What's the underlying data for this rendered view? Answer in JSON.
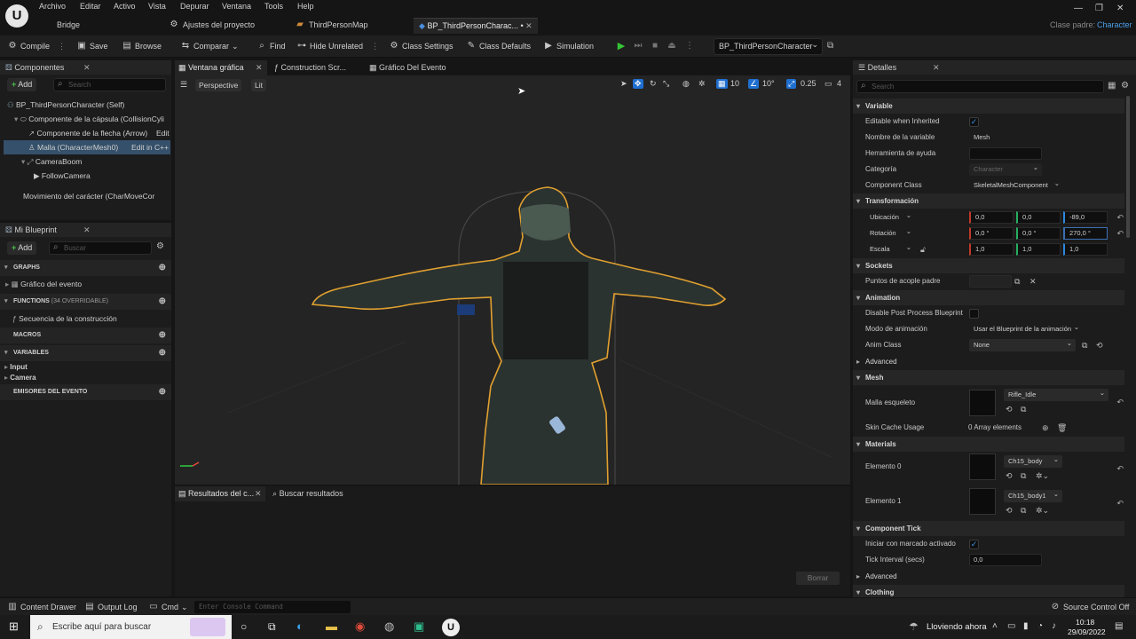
{
  "menu": [
    "Archivo",
    "Editar",
    "Activo",
    "Vista",
    "Depurar",
    "Ventana",
    "Tools",
    "Help"
  ],
  "project_tabs": [
    "Bridge",
    "Ajustes del proyecto",
    "ThirdPersonMap",
    "BP_ThirdPersonCharac... •"
  ],
  "parent_class_label": "Clase padre:",
  "parent_class_value": "Character",
  "toolbar": {
    "compile": "Compile",
    "save": "Save",
    "browse": "Browse",
    "compare": "Comparar",
    "find": "Find",
    "hide_unrelated": "Hide Unrelated",
    "class_settings": "Class Settings",
    "class_defaults": "Class Defaults",
    "simulation": "Simulation",
    "debug_object": "BP_ThirdPersonCharacter"
  },
  "components_panel": {
    "title": "Componentes",
    "add": "Add",
    "search_placeholder": "Search",
    "items": [
      {
        "label": "BP_ThirdPersonCharacter (Self)"
      },
      {
        "label": "Componente de la cápsula (CollisionCyli"
      },
      {
        "label": "Componente de la flecha (Arrow)",
        "action": "Edit"
      },
      {
        "label": "Malla (CharacterMesh0)",
        "action": "Edit in C++"
      },
      {
        "label": "CameraBoom"
      },
      {
        "label": "FollowCamera"
      },
      {
        "label": "Movimiento del carácter (CharMoveCor"
      }
    ]
  },
  "blueprint_panel": {
    "title": "Mi Blueprint",
    "add": "Add",
    "search_placeholder": "Buscar",
    "sections": {
      "graphs": "GRAPHS",
      "graph_item": "Gráfico del evento",
      "functions": "FUNCTIONS",
      "functions_note": "(34 OVERRIDABLE)",
      "function_item": "Secuencia de la construcción",
      "macros": "MACROS",
      "variables": "VARIABLES",
      "var_input": "Input",
      "var_camera": "Camera",
      "dispatchers": "EMISORES DEL EVENTO"
    }
  },
  "editor_tabs": [
    "Ventana gráfica",
    "Construction Scr...",
    "Gráfico Del Evento"
  ],
  "viewport": {
    "perspective": "Perspective",
    "lit": "Lit",
    "grid": "10",
    "angle": "10°",
    "scale": "0.25",
    "camera_speed": "4"
  },
  "results_panel": {
    "tab": "Resultados del c...",
    "search": "Buscar resultados",
    "clear": "Borrar"
  },
  "details": {
    "title": "Detalles",
    "search_placeholder": "Search",
    "variable_section": "Variable",
    "editable_inherited": "Editable when Inherited",
    "var_name_label": "Nombre de la variable",
    "var_name_value": "Mesh",
    "tooltip_label": "Herramienta de ayuda",
    "category_label": "Categoría",
    "category_value": "Character",
    "component_class_label": "Component Class",
    "component_class_value": "SkeletalMeshComponent",
    "transform_section": "Transformación",
    "location": "Ubicación",
    "rotation": "Rotación",
    "scale": "Escala",
    "loc": [
      "0,0",
      "0,0",
      "-89,0"
    ],
    "rot": [
      "0,0 °",
      "0,0 °",
      "270,0 °"
    ],
    "scl": [
      "1,0",
      "1,0",
      "1,0"
    ],
    "sockets_section": "Sockets",
    "parent_socket": "Puntos de acople padre",
    "animation_section": "Animation",
    "disable_post": "Disable Post Process Blueprint",
    "anim_mode_label": "Modo de animación",
    "anim_mode_value": "Usar el Blueprint de la animación",
    "anim_class_label": "Anim Class",
    "anim_class_value": "None",
    "advanced": "Advanced",
    "mesh_section": "Mesh",
    "skeletal_mesh_label": "Malla esqueleto",
    "skeletal_mesh_value": "Rifle_Idle",
    "skin_cache_label": "Skin Cache Usage",
    "skin_cache_value": "0 Array elements",
    "materials_section": "Materials",
    "elem0_label": "Elemento 0",
    "elem0_value": "Ch15_body",
    "elem1_label": "Elemento 1",
    "elem1_value": "Ch15_body1",
    "tick_section": "Component Tick",
    "tick_start_label": "Iniciar con marcado activado",
    "tick_interval_label": "Tick Interval (secs)",
    "tick_interval_value": "0,0",
    "advanced2": "Advanced",
    "clothing_section": "Clothing"
  },
  "statusbar": {
    "content_drawer": "Content Drawer",
    "output_log": "Output Log",
    "cmd": "Cmd",
    "console_placeholder": "Enter Console Command",
    "source_control": "Source Control Off"
  },
  "taskbar": {
    "search_placeholder": "Escribe aquí para buscar",
    "weather": "Lloviendo ahora",
    "time": "10:18",
    "date": "29/09/2022"
  },
  "colors": {
    "accent": "#1f6fd0",
    "selection": "#35506a",
    "outline": "#e0a030",
    "play": "#35c535"
  }
}
